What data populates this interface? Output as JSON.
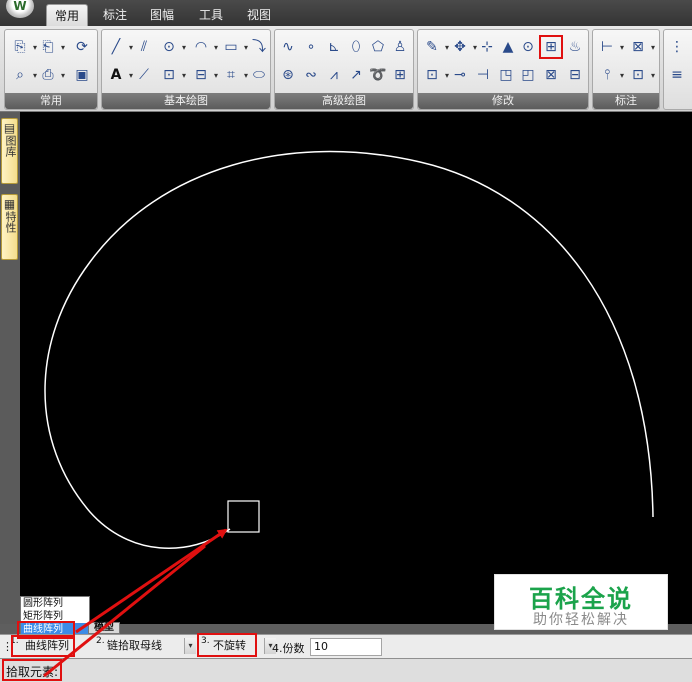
{
  "app": {
    "logo_glyph": "W",
    "tabs": [
      {
        "label": "常用",
        "active": true
      },
      {
        "label": "标注"
      },
      {
        "label": "图幅"
      },
      {
        "label": "工具"
      },
      {
        "label": "视图"
      }
    ]
  },
  "ribbon": {
    "groups": [
      {
        "title": "常用"
      },
      {
        "title": "基本绘图"
      },
      {
        "title": "高级绘图"
      },
      {
        "title": "修改"
      },
      {
        "title": "标注"
      }
    ],
    "icons": {
      "common_row1": [
        "⎘",
        "⎗",
        "⟳"
      ],
      "common_row2": [
        "⌕",
        "⎙",
        "▣"
      ],
      "draw_row1": [
        "╱",
        "⫽",
        "⊙",
        "◠",
        "▭",
        "⤵"
      ],
      "draw_row2": [
        "A",
        "⟋",
        "⊡",
        "⊟",
        "⌗",
        "⬭"
      ],
      "adv_row1": [
        "∿",
        "∘",
        "⊾",
        "⬯",
        "⬠",
        "♙"
      ],
      "adv_row2": [
        "⊛",
        "∾",
        "⩘",
        "↗",
        "➰",
        "⊞"
      ],
      "mod_row1": [
        "✎",
        "✥",
        "⊹",
        "▲",
        "⊙",
        "⊞",
        "♨"
      ],
      "mod_row2": [
        "⊡",
        "⊸",
        "⊣",
        "◳",
        "◰",
        "⊠",
        "⊟"
      ],
      "dim_row1": [
        "⊢",
        "⊠"
      ],
      "dim_row2": [
        "⫯",
        "⊡"
      ],
      "extra_row1": [
        "⋮"
      ],
      "extra_row2": [
        "≡"
      ]
    }
  },
  "sidepanel": {
    "tab1": "图库",
    "tab2": "特性"
  },
  "watermark": {
    "title": "百科全说",
    "subtitle": "助你轻松解决"
  },
  "dropdown": {
    "options": [
      "圆形阵列",
      "矩形阵列",
      "曲线阵列"
    ],
    "selected_index": 2,
    "model_tab": "模型"
  },
  "cmdbar": {
    "grip": "⋮",
    "opt1_prefix": "1.",
    "opt1_value": "曲线阵列",
    "opt2_prefix": "2.",
    "opt2_value": "链拾取母线",
    "opt3_prefix": "3.",
    "opt3_value": "不旋转",
    "opt4_label": "4.份数",
    "opt4_value": "10"
  },
  "status": {
    "prompt": "拾取元素:"
  },
  "colors": {
    "annotation": "#e01010",
    "canvas_bg": "#000000",
    "curve": "#ffffff",
    "dropdown_selected": "#3d8ce6",
    "watermark_green": "#1ba34b"
  }
}
